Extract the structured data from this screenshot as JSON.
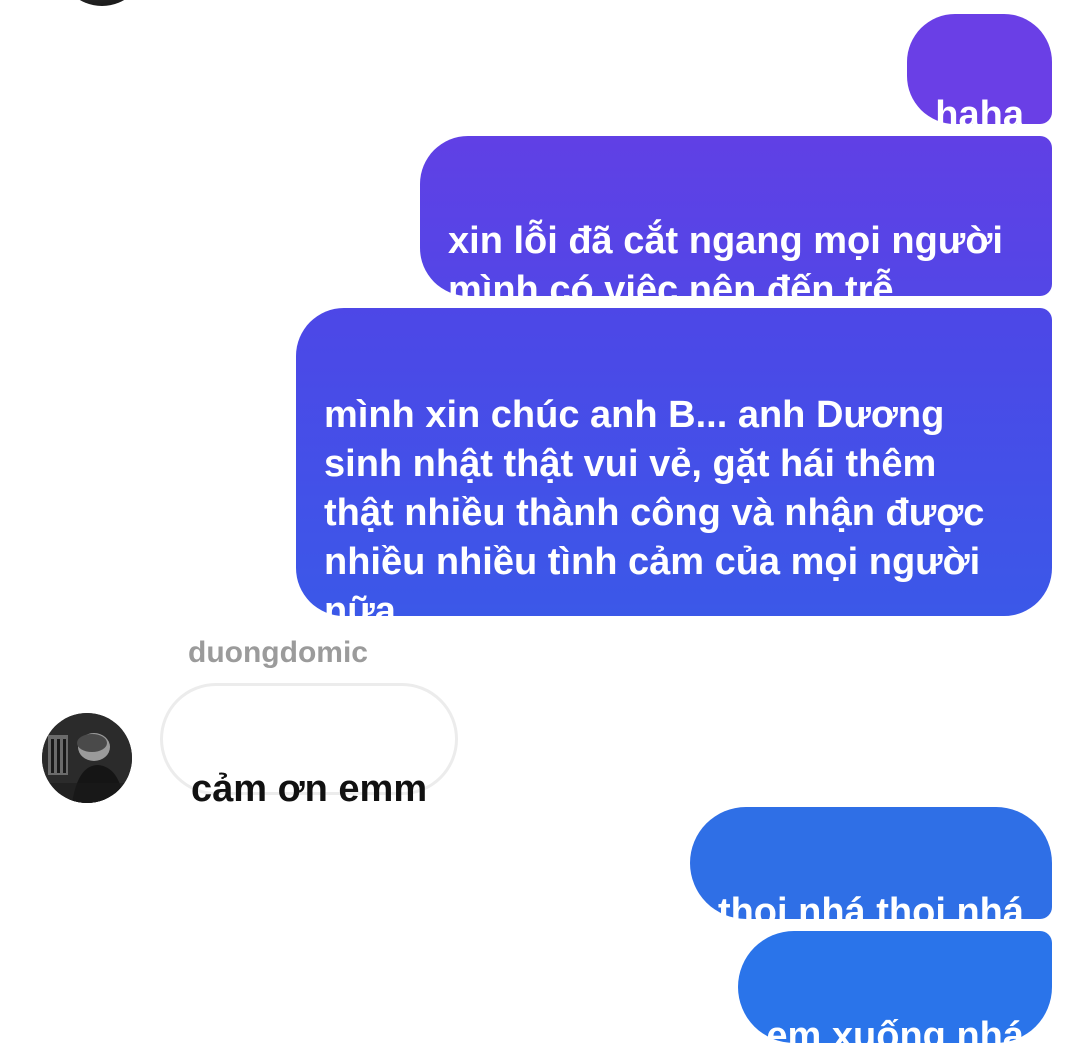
{
  "messages": {
    "m1": "haha",
    "m2": "xin lỗi đã cắt ngang mọi người\nmình có việc nên đến trễ",
    "m3": "mình xin chúc anh B... anh Dương\nsinh nhật thật vui vẻ, gặt hái thêm\nthật nhiều thành công và nhận được\nnhiều nhiều tình cảm của mọi người\nnữa",
    "m4_sender": "duongdomic",
    "m4": "cảm ơn emm",
    "m5": "thoi nhá thoi nhá",
    "m6": "em xuống nhá"
  },
  "colors": {
    "outgoing_top": "#6a3fe6",
    "outgoing_mid": "#4d47e7",
    "outgoing_bottom": "#2a74ea",
    "incoming_border": "#ececec",
    "sender_name": "#9b9b9b"
  },
  "icons": {
    "avatar": "user-avatar-photo"
  }
}
